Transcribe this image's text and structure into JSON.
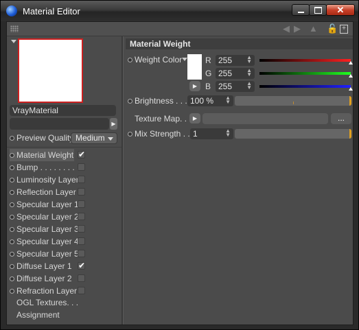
{
  "window": {
    "title": "Material Editor"
  },
  "colors": {
    "preview_border": "#cc2020",
    "red": "#ff2020",
    "green": "#20ff20",
    "blue": "#2020ff",
    "accent": "#e0a020"
  },
  "toolbar": {
    "icons": [
      "back-arrow-icon",
      "forward-arrow-icon",
      "up-arrow-icon",
      "lock-icon",
      "new-window-icon"
    ]
  },
  "left": {
    "material_name": "VrayMaterial",
    "preview_quality_label": "Preview Quality",
    "preview_quality_value": "Medium",
    "channels": [
      {
        "label": "Material Weight",
        "checked": true,
        "selected": true
      },
      {
        "label": "Bump . . . . . . . . .",
        "checked": false
      },
      {
        "label": "Luminosity Layer",
        "checked": false
      },
      {
        "label": "Reflection Layer",
        "checked": false
      },
      {
        "label": "Specular Layer 1",
        "checked": false
      },
      {
        "label": "Specular Layer 2",
        "checked": false
      },
      {
        "label": "Specular Layer 3",
        "checked": false
      },
      {
        "label": "Specular Layer 4",
        "checked": false
      },
      {
        "label": "Specular Layer 5",
        "checked": false
      },
      {
        "label": "Diffuse Layer 1",
        "checked": true
      },
      {
        "label": "Diffuse Layer 2",
        "checked": false
      },
      {
        "label": "Refraction Layer",
        "checked": false
      }
    ],
    "extra_items": [
      "OGL Textures. . .",
      "Assignment"
    ]
  },
  "right": {
    "section_title": "Material Weight",
    "weight_color_label": "Weight Color",
    "r_label": "R",
    "r_value": "255",
    "g_label": "G",
    "g_value": "255",
    "b_label": "B",
    "b_value": "255",
    "brightness_label": "Brightness  . . . .",
    "brightness_value": "100 %",
    "texture_map_label": "Texture Map. . .",
    "browse_button": "...",
    "mix_strength_label": "Mix Strength . . .",
    "mix_strength_value": "1"
  }
}
